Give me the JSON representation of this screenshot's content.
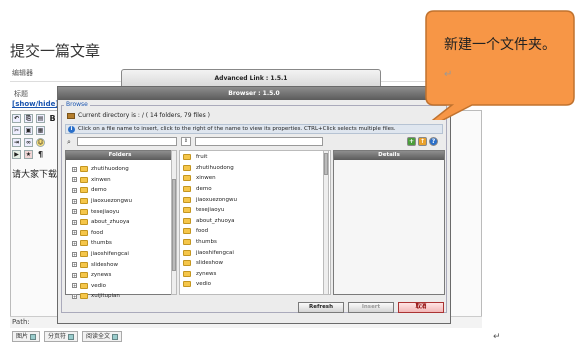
{
  "page": {
    "title": "提交一篇文章",
    "editor_label": "编辑器",
    "title_label": "标题",
    "show_hide": "[show/hide]",
    "editor_text": "请大家下载",
    "path_label": "Path:",
    "return_mark": "↵"
  },
  "toolbar": {
    "row1": [
      "B",
      "I"
    ],
    "row2": [
      "¶"
    ]
  },
  "bottom_buttons": [
    {
      "label": "图片"
    },
    {
      "label": "分页符"
    },
    {
      "label": "阅读全文"
    }
  ],
  "advanced_link": {
    "title": "Advanced Link : 1.5.1"
  },
  "browser": {
    "title": "Browser : 1.5.0",
    "fieldset_legend": "Browse",
    "current_directory": "Current directory is : / ( 14 folders, 79 files )",
    "instructions": "Click on a file name to insert, click to the right of the name to view its properties. CTRL+Click selects multiple files.",
    "sort_symbol": "⇕",
    "folders_header": "Folders",
    "details_header": "Details",
    "folders": [
      "zhutihuodong",
      "xinwen",
      "demo",
      "jiaoxuezongwu",
      "tesejiaoyu",
      "about_zhuoya",
      "food",
      "thumbs",
      "jiaoshifengcai",
      "slideshow",
      "zynews",
      "vedio",
      "xuijitupian"
    ],
    "files": [
      "fruit",
      "zhutihuodong",
      "xinwen",
      "demo",
      "jiaoxuezongwu",
      "tesejiaoyu",
      "about_zhuoya",
      "food",
      "thumbs",
      "jiaoshifengcai",
      "slideshow",
      "zynews",
      "vedio"
    ],
    "buttons": {
      "refresh": "Refresh",
      "insert": "Insert",
      "cancel": "取消"
    }
  },
  "callout": {
    "text": "新建一个文件夹。",
    "return_mark": "↵",
    "color": "#f79646"
  }
}
